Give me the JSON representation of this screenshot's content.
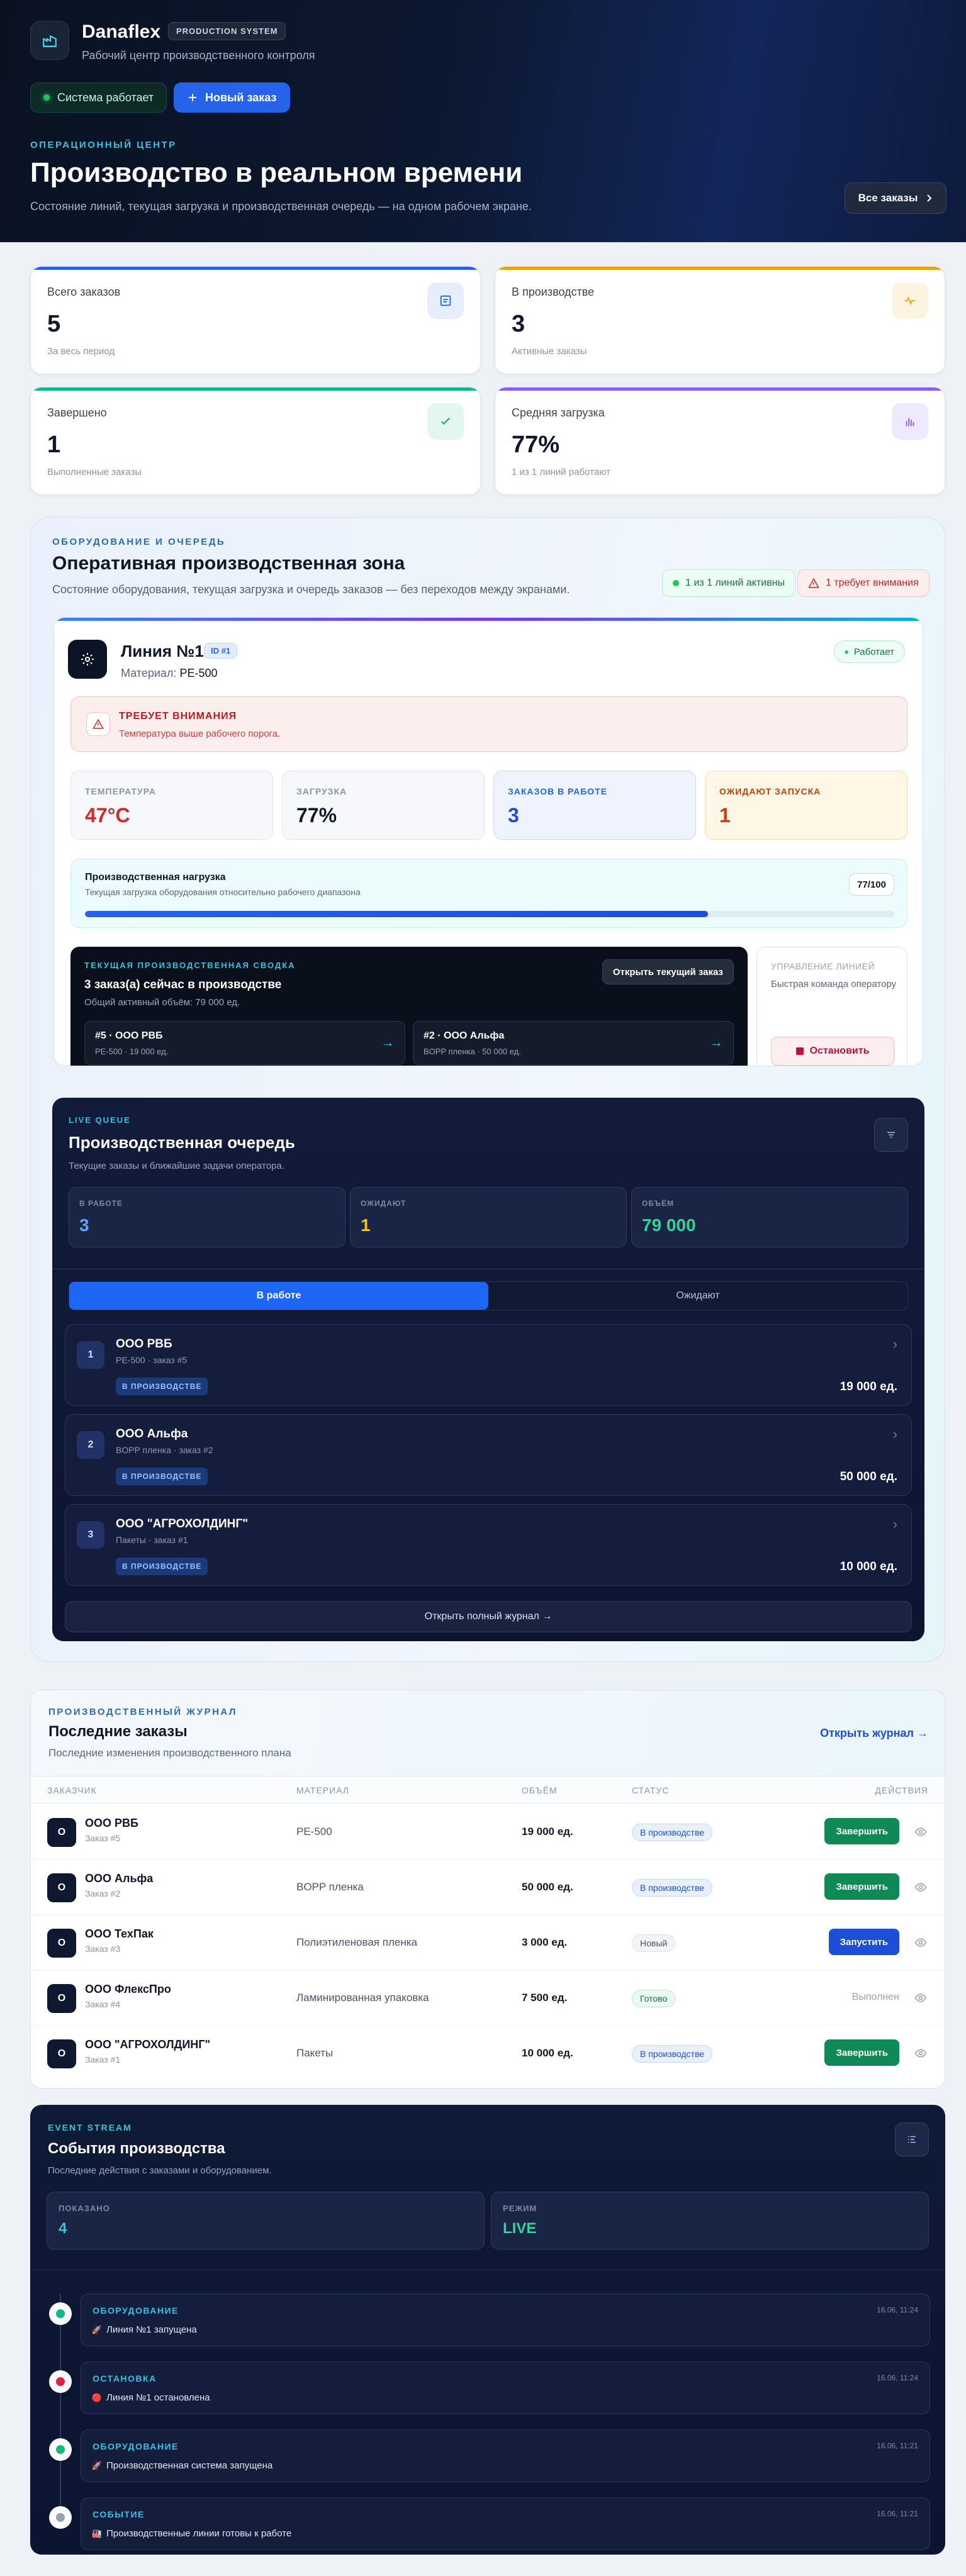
{
  "brand": {
    "name": "Danaflex",
    "tag": "PRODUCTION SYSTEM",
    "subtitle": "Рабочий центр производственного контроля"
  },
  "hero": {
    "system_status": "Система работает",
    "new_order": "Новый заказ",
    "kicker": "ОПЕРАЦИОННЫЙ ЦЕНТР",
    "title": "Производство в реальном времени",
    "description": "Состояние линий, текущая загрузка и производственная очередь — на одном рабочем экране.",
    "all_orders": "Все заказы"
  },
  "stats": [
    {
      "label": "Всего заказов",
      "value": "5",
      "sub": "За весь период",
      "accent": "#2563eb",
      "icon": "document-icon"
    },
    {
      "label": "В производстве",
      "value": "3",
      "sub": "Активные заказы",
      "accent": "#f59e0b",
      "icon": "pulse-icon"
    },
    {
      "label": "Завершено",
      "value": "1",
      "sub": "Выполненные заказы",
      "accent": "#10b981",
      "icon": "check-icon"
    },
    {
      "label": "Средняя загрузка",
      "value": "77%",
      "sub": "1 из 1 линий работают",
      "accent": "#8b5cf6",
      "icon": "bar-chart-icon"
    }
  ],
  "zone": {
    "kicker": "ОБОРУДОВАНИЕ И ОЧЕРЕДЬ",
    "title": "Оперативная производственная зона",
    "description": "Состояние оборудования, текущая загрузка и очередь заказов — без переходов между экранами.",
    "active_pill": "1 из 1 линий активны",
    "warn_pill": "1 требует внимания"
  },
  "line": {
    "name": "Линия №1",
    "id": "ID #1",
    "material_label": "Материал:",
    "material": "PE-500",
    "status": "Работает",
    "alert_title": "ТРЕБУЕТ ВНИМАНИЯ",
    "alert_text": "Температура выше рабочего порога.",
    "metrics": [
      {
        "label": "ТЕМПЕРАТУРА",
        "value": "47°C",
        "color": "#dc2626"
      },
      {
        "label": "ЗАГРУЗКА",
        "value": "77%",
        "color": "#0f172a"
      },
      {
        "label": "ЗАКАЗОВ В РАБОТЕ",
        "value": "3",
        "color": "#1d4ed8"
      },
      {
        "label": "ОЖИДАЮТ ЗАПУСКА",
        "value": "1",
        "color": "#c2410c"
      }
    ],
    "load_title": "Производственная нагрузка",
    "load_sub": "Текущая загрузка оборудования относительно рабочего диапазона",
    "load_badge": "77/100",
    "load_value": 0.77,
    "summary_kicker": "ТЕКУЩАЯ ПРОИЗВОДСТВЕННАЯ СВОДКА",
    "summary_title": "3 заказ(а) сейчас в производстве",
    "summary_sub": "Общий активный объём: 79 000 ед.",
    "summary_open": "Открыть текущий заказ",
    "chips": [
      {
        "title": "#5 · ООО РВБ",
        "sub": "PE-500 · 19 000 ед."
      },
      {
        "title": "#2 · ООО Альфа",
        "sub": "BOPP пленка · 50 000 ед."
      }
    ],
    "control_kicker": "УПРАВЛЕНИЕ ЛИНИЕЙ",
    "control_sub": "Быстрая команда оператору",
    "stop": "Остановить"
  },
  "queue": {
    "kicker": "LIVE QUEUE",
    "title": "Производственная очередь",
    "description": "Текущие заказы и ближайшие задачи оператора.",
    "stats": [
      {
        "label": "В РАБОТЕ",
        "value": "3",
        "color": "#60a5fa"
      },
      {
        "label": "ОЖИДАЮТ",
        "value": "1",
        "color": "#fbbf24"
      },
      {
        "label": "ОБЪЁМ",
        "value": "79 000",
        "color": "#34d399"
      }
    ],
    "tabs": [
      "В работе",
      "Ожидают"
    ],
    "items": [
      {
        "num": "1",
        "name": "ООО РВБ",
        "sub": "PE-500 · заказ #5",
        "tag": "В ПРОИЗВОДСТВЕ",
        "volume": "19 000 ед."
      },
      {
        "num": "2",
        "name": "ООО Альфа",
        "sub": "BOPP пленка · заказ #2",
        "tag": "В ПРОИЗВОДСТВЕ",
        "volume": "50 000 ед."
      },
      {
        "num": "3",
        "name": "ООО \"АГРОХОЛДИНГ\"",
        "sub": "Пакеты · заказ #1",
        "tag": "В ПРОИЗВОДСТВЕ",
        "volume": "10 000 ед."
      }
    ],
    "journal": "Открыть полный журнал →"
  },
  "orders": {
    "kicker": "ПРОИЗВОДСТВЕННЫЙ ЖУРНАЛ",
    "title": "Последние заказы",
    "description": "Последние изменения производственного плана",
    "open_journal": "Открыть журнал →",
    "columns": [
      "ЗАКАЗЧИК",
      "МАТЕРИАЛ",
      "ОБЪЁМ",
      "СТАТУС",
      "ДЕЙСТВИЯ"
    ],
    "rows": [
      {
        "avatar": "О",
        "customer": "ООО РВБ",
        "order": "Заказ #5",
        "material": "PE-500",
        "volume": "19 000 ед.",
        "status": "В производстве",
        "status_kind": "prod",
        "action": "Завершить",
        "action_kind": "finish"
      },
      {
        "avatar": "О",
        "customer": "ООО Альфа",
        "order": "Заказ #2",
        "material": "BOPP пленка",
        "volume": "50 000 ед.",
        "status": "В производстве",
        "status_kind": "prod",
        "action": "Завершить",
        "action_kind": "finish"
      },
      {
        "avatar": "О",
        "customer": "ООО ТехПак",
        "order": "Заказ #3",
        "material": "Полиэтиленовая пленка",
        "volume": "3 000 ед.",
        "status": "Новый",
        "status_kind": "new",
        "action": "Запустить",
        "action_kind": "start"
      },
      {
        "avatar": "О",
        "customer": "ООО ФлексПро",
        "order": "Заказ #4",
        "material": "Ламинированная упаковка",
        "volume": "7 500 ед.",
        "status": "Готово",
        "status_kind": "done",
        "action": "Выполнен",
        "action_kind": "text"
      },
      {
        "avatar": "О",
        "customer": "ООО \"АГРОХОЛДИНГ\"",
        "order": "Заказ #1",
        "material": "Пакеты",
        "volume": "10 000 ед.",
        "status": "В производстве",
        "status_kind": "prod",
        "action": "Завершить",
        "action_kind": "finish"
      }
    ]
  },
  "events": {
    "kicker": "EVENT STREAM",
    "title": "События производства",
    "description": "Последние действия с заказами и оборудованием.",
    "stats": [
      {
        "label": "ПОКАЗАНО",
        "value": "4",
        "color": "#35c2e0"
      },
      {
        "label": "РЕЖИМ",
        "value": "LIVE",
        "color": "#34d399"
      }
    ],
    "items": [
      {
        "category": "ОБОРУДОВАНИЕ",
        "message": "Линия №1 запущена",
        "time": "16.06, 11:24",
        "dot": "#10b981",
        "icon": "rocket-icon",
        "glyph": "🚀"
      },
      {
        "category": "ОСТАНОВКА",
        "message": "Линия №1 остановлена",
        "time": "16.06, 11:24",
        "dot": "#e11d48",
        "icon": "red-circle-icon",
        "glyph": "🔴"
      },
      {
        "category": "ОБОРУДОВАНИЕ",
        "message": "Производственная система запущена",
        "time": "16.06, 11:21",
        "dot": "#10b981",
        "icon": "rocket-icon",
        "glyph": "🚀"
      },
      {
        "category": "СОБЫТИЕ",
        "message": "Производственные линии готовы к работе",
        "time": "16.06, 11:21",
        "dot": "#94a3b8",
        "icon": "factory-icon",
        "glyph": "🏭"
      }
    ]
  }
}
